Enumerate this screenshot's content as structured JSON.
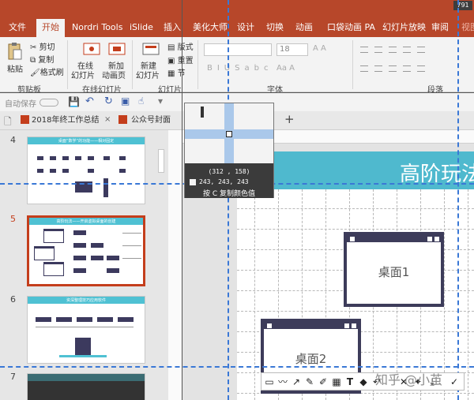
{
  "ribbon": {
    "tabs": [
      "文件",
      "开始",
      "Nordri Tools",
      "iSlide",
      "插入",
      "美化大师",
      "设计",
      "切换",
      "动画",
      "口袋动画 PA",
      "幻灯片放映",
      "审阅",
      "视图"
    ],
    "active_tab": "开始",
    "corner_number": "791",
    "clipboard": {
      "paste": "粘贴",
      "cut": "剪切",
      "copy": "复制",
      "format_painter": "格式刷",
      "group": "剪贴板"
    },
    "online_slides": {
      "online": "在线",
      "online2": "幻灯片",
      "new": "新加",
      "new2": "动画页",
      "group": "在线幻灯片"
    },
    "slides": {
      "new": "新建",
      "new2": "幻灯片",
      "layout": "版式",
      "reset": "重置",
      "section": "节",
      "group": "幻灯片"
    },
    "font": {
      "size": "18",
      "group": "字体"
    },
    "paragraph": {
      "group": "段落"
    }
  },
  "qat": {
    "autosave": "自动保存"
  },
  "doc_tabs": [
    "2018年终工作总结",
    "公众号封面"
  ],
  "thumbnails": [
    {
      "number": "4",
      "title": "桌面“数学”的功能——相对固定",
      "labels": [
        "Y分类",
        "分类"
      ]
    },
    {
      "number": "5",
      "title": "高阶玩法——开启虚拟桌面的创建",
      "labels": [
        "打开 “任务视图”",
        "点击 “新建桌面”",
        "使用快捷键"
      ]
    },
    {
      "number": "6",
      "title": "资深整理技巧应用软件",
      "labels": []
    },
    {
      "number": "7",
      "title": "",
      "labels": []
    }
  ],
  "selected_slide": "5",
  "slide": {
    "title": "高阶玩法",
    "desktop1": "桌面1",
    "desktop2": "桌面2"
  },
  "magnifier": {
    "coords": "(312 , 158)",
    "rgb": "243, 243, 243",
    "hint": "按 C 复制颜色值"
  },
  "toolbar": {
    "icons": [
      "rectangle-icon",
      "circle-icon",
      "curve-icon",
      "arrow-icon",
      "pen-icon",
      "marker-icon",
      "mosaic-icon",
      "text-icon",
      "eraser-icon",
      "undo-icon",
      "close-icon",
      "pin-icon",
      "save-icon",
      "confirm-icon"
    ]
  },
  "watermark": "知乎 @小茧",
  "colors": {
    "accent": "#b7472a",
    "slide_header": "#4fb9ce",
    "desktop_frame": "#3d3c5a",
    "guide": "#3a78d6"
  }
}
